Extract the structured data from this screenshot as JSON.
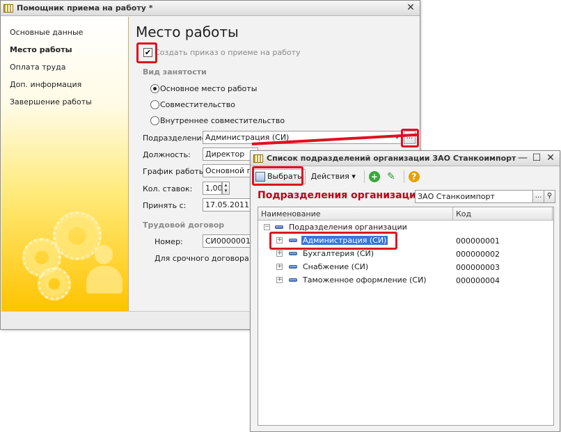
{
  "window1": {
    "title": "Помощник приема на работу *",
    "close_label": "✕",
    "sidebar": {
      "items": [
        {
          "label": "Основные данные"
        },
        {
          "label": "Место работы"
        },
        {
          "label": "Оплата труда"
        },
        {
          "label": "Доп. информация"
        },
        {
          "label": "Завершение работы"
        }
      ]
    },
    "page_title": "Место работы",
    "create_order_checkbox": {
      "label": "Создать приказ о приеме на работу",
      "checked": "✔"
    },
    "employment_group": {
      "title": "Вид занятости",
      "options": [
        {
          "label": "Основное место работы"
        },
        {
          "label": "Совместительство"
        },
        {
          "label": "Внутреннее совместительство"
        }
      ]
    },
    "fields": {
      "department": {
        "label": "Подразделение:",
        "value": "Администрация (СИ)"
      },
      "position": {
        "label": "Должность:",
        "value": "Директор"
      },
      "schedule": {
        "label": "График работы:",
        "value": "Основной гр"
      },
      "rate": {
        "label": "Кол. ставок:",
        "value": "1,00"
      },
      "hire_date": {
        "label": "Принять с:",
        "value": "17.05.2011"
      }
    },
    "contract_group": {
      "title": "Трудовой договор",
      "number_label": "Номер:",
      "number_value": "СИ0000001",
      "fixed_term_text": "Для срочного договора дат"
    },
    "ellipsis_label": "..."
  },
  "window2": {
    "title": "Список подразделений организации ЗАО Станкоимпорт",
    "controls": {
      "minimize": "—",
      "maximize": "☐",
      "close": "✕"
    },
    "toolbar": {
      "select_label": "Выбрать",
      "actions_label": "Действия ▾"
    },
    "heading": "Подразделения организации",
    "org_field": {
      "value": "ЗАО Станкоимпорт",
      "ellipsis": "...",
      "search": "⚲"
    },
    "columns": [
      "Наименование",
      "Код"
    ],
    "tree_root": {
      "name": "Подразделения организации"
    },
    "rows": [
      {
        "name": "Администрация (СИ)",
        "code": "000000001",
        "selected": true
      },
      {
        "name": "Бухгалтерия (СИ)",
        "code": "000000002"
      },
      {
        "name": "Снабжение (СИ)",
        "code": "000000003"
      },
      {
        "name": "Таможенное оформление (СИ)",
        "code": "000000004"
      }
    ]
  },
  "colors": {
    "highlight": "#e01020",
    "selection": "#3875d7",
    "heading_red": "#c00018",
    "sidebar_yellow": "#ffc300"
  }
}
